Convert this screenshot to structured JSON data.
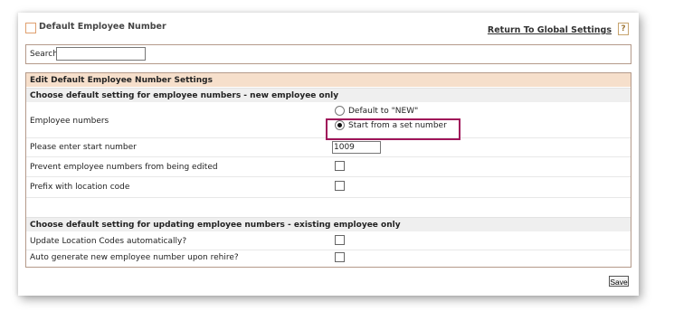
{
  "header": {
    "title": "Default Employee Number",
    "return_link": "Return To Global Settings",
    "help": "?"
  },
  "search": {
    "label": "Search",
    "value": ""
  },
  "settings": {
    "title": "Edit Default Employee Number Settings",
    "new_section": {
      "title": "Choose default setting for employee numbers - new employee only",
      "employee_numbers_label": "Employee numbers",
      "radio_options": [
        {
          "label": "Default to \"NEW\"",
          "checked": false
        },
        {
          "label": "Start from a set number",
          "checked": true
        }
      ],
      "start_number_label": "Please enter start number",
      "start_number_value": "1009",
      "prevent_edit_label": "Prevent employee numbers from being edited",
      "prefix_label": "Prefix with location code"
    },
    "existing_section": {
      "title": "Choose default setting for updating employee numbers - existing employee only",
      "update_location_label": "Update Location Codes automatically?",
      "auto_generate_label": "Auto generate new employee number upon rehire?"
    }
  },
  "save_label": "Save",
  "colors": {
    "section_header_bg": "#f6dfcb",
    "highlight_border": "#a0145a"
  }
}
